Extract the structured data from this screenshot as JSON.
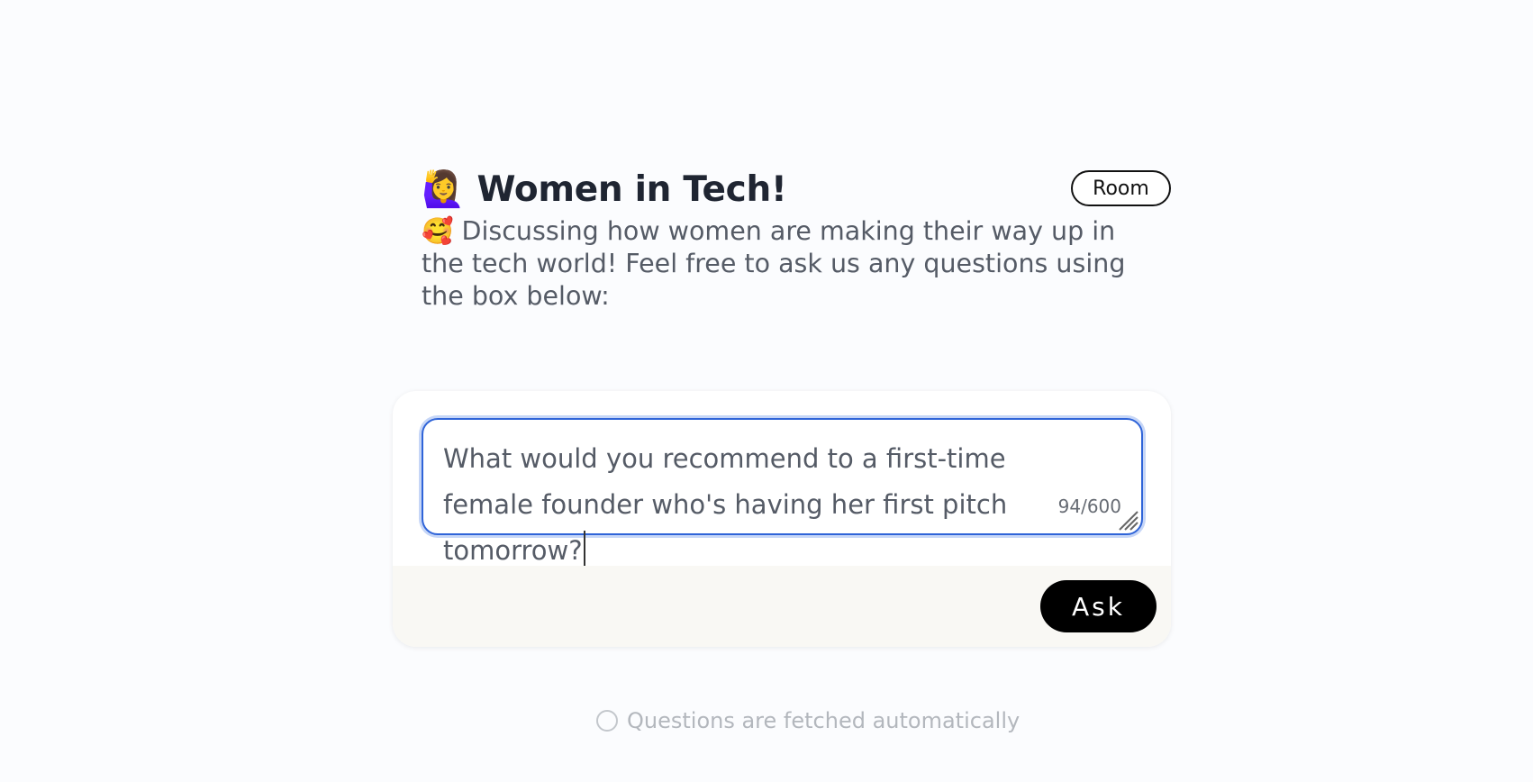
{
  "room": {
    "title": "🙋‍♀️ Women in Tech!",
    "badge": "Room",
    "description": "🥰 Discussing how women are making their way up in the tech world! Feel free to ask us any questions using the box below:"
  },
  "question_form": {
    "value": "What would you recommend to a first-time female founder who's having her first pitch tomorrow?",
    "counter": "94/600",
    "submit_label": "Ask"
  },
  "status": {
    "text": "Questions are fetched automatically"
  },
  "colors": {
    "accent": "#2f64d8",
    "button": "#000000",
    "title": "#1f2532",
    "footer_bg": "#f9f8f4"
  }
}
